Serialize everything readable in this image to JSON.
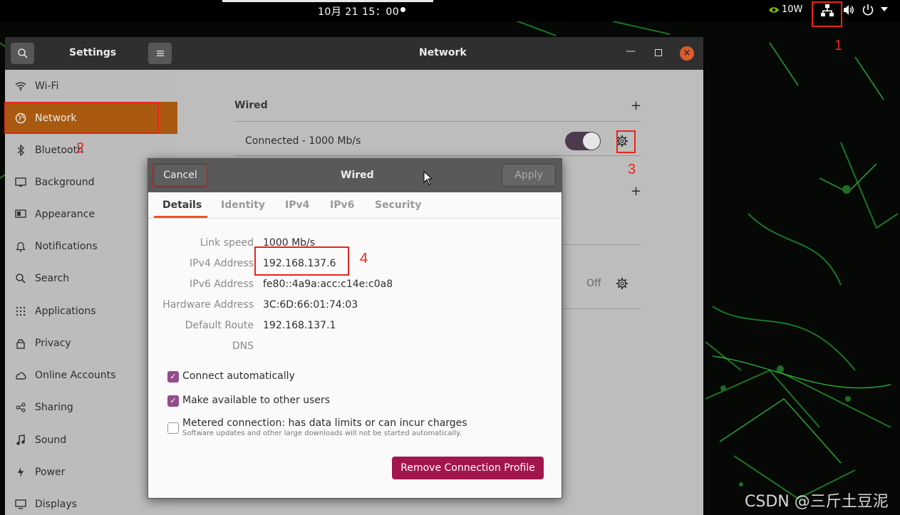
{
  "topbar": {
    "clock": "10月 21 15：00",
    "gpu_power": "10W",
    "icons": [
      "nvidia-icon",
      "network-icon",
      "volume-icon",
      "power-icon",
      "menu-caret-icon"
    ]
  },
  "settings_window": {
    "settings_title": "Settings",
    "panel_title": "Network",
    "sidebar": {
      "items": [
        {
          "label": "Wi-Fi",
          "icon": "wifi-icon"
        },
        {
          "label": "Network",
          "icon": "network-globe-icon",
          "active": true
        },
        {
          "label": "Bluetooth",
          "icon": "bluetooth-icon"
        },
        {
          "label": "Background",
          "icon": "background-icon"
        },
        {
          "label": "Appearance",
          "icon": "appearance-icon"
        },
        {
          "label": "Notifications",
          "icon": "bell-icon"
        },
        {
          "label": "Search",
          "icon": "search-icon"
        },
        {
          "label": "Applications",
          "icon": "grid-icon"
        },
        {
          "label": "Privacy",
          "icon": "lock-icon"
        },
        {
          "label": "Online Accounts",
          "icon": "cloud-icon"
        },
        {
          "label": "Sharing",
          "icon": "share-icon"
        },
        {
          "label": "Sound",
          "icon": "music-note-icon"
        },
        {
          "label": "Power",
          "icon": "power-icon"
        },
        {
          "label": "Displays",
          "icon": "display-icon"
        }
      ]
    },
    "content": {
      "wired_heading": "Wired",
      "wired_status": "Connected - 1000 Mb/s",
      "wired_toggle_on": true,
      "proxy_status": "Off",
      "plus_symbol": "+"
    }
  },
  "dialog": {
    "title": "Wired",
    "cancel_label": "Cancel",
    "apply_label": "Apply",
    "tabs": [
      "Details",
      "Identity",
      "IPv4",
      "IPv6",
      "Security"
    ],
    "active_tab": "Details",
    "details": [
      {
        "label": "Link speed",
        "value": "1000 Mb/s"
      },
      {
        "label": "IPv4 Address",
        "value": "192.168.137.6"
      },
      {
        "label": "IPv6 Address",
        "value": "fe80::4a9a:acc:c14e:c0a8"
      },
      {
        "label": "Hardware Address",
        "value": "3C:6D:66:01:74:03"
      },
      {
        "label": "Default Route",
        "value": "192.168.137.1"
      },
      {
        "label": "DNS",
        "value": ""
      }
    ],
    "options": [
      {
        "label": "Connect automatically",
        "checked": true
      },
      {
        "label": "Make available to other users",
        "checked": true
      },
      {
        "label": "Metered connection: has data limits or can incur charges",
        "checked": false,
        "sublabel": "Software updates and other large downloads will not be started automatically."
      }
    ],
    "remove_label": "Remove Connection Profile"
  },
  "annotations": {
    "numbers": [
      "1",
      "2",
      "3",
      "4"
    ],
    "color": "#e8251c"
  },
  "watermark": "CSDN @三斤土豆泥"
}
